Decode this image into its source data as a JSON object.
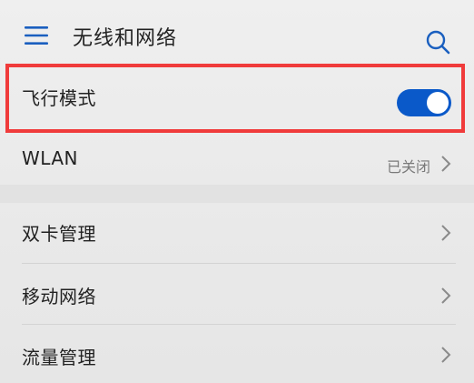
{
  "header": {
    "title": "无线和网络",
    "menu_icon": "hamburger-menu-icon",
    "search_icon": "search-icon"
  },
  "rows": {
    "airplane_mode": {
      "label": "飞行模式",
      "toggle_on": true
    },
    "wlan": {
      "label": "WLAN",
      "value": "已关闭"
    },
    "dual_sim": {
      "label": "双卡管理"
    },
    "mobile_network": {
      "label": "移动网络"
    },
    "data_management": {
      "label": "流量管理"
    }
  },
  "colors": {
    "toggle_active": "#0a59c9",
    "highlight_border": "#f03b3b"
  }
}
